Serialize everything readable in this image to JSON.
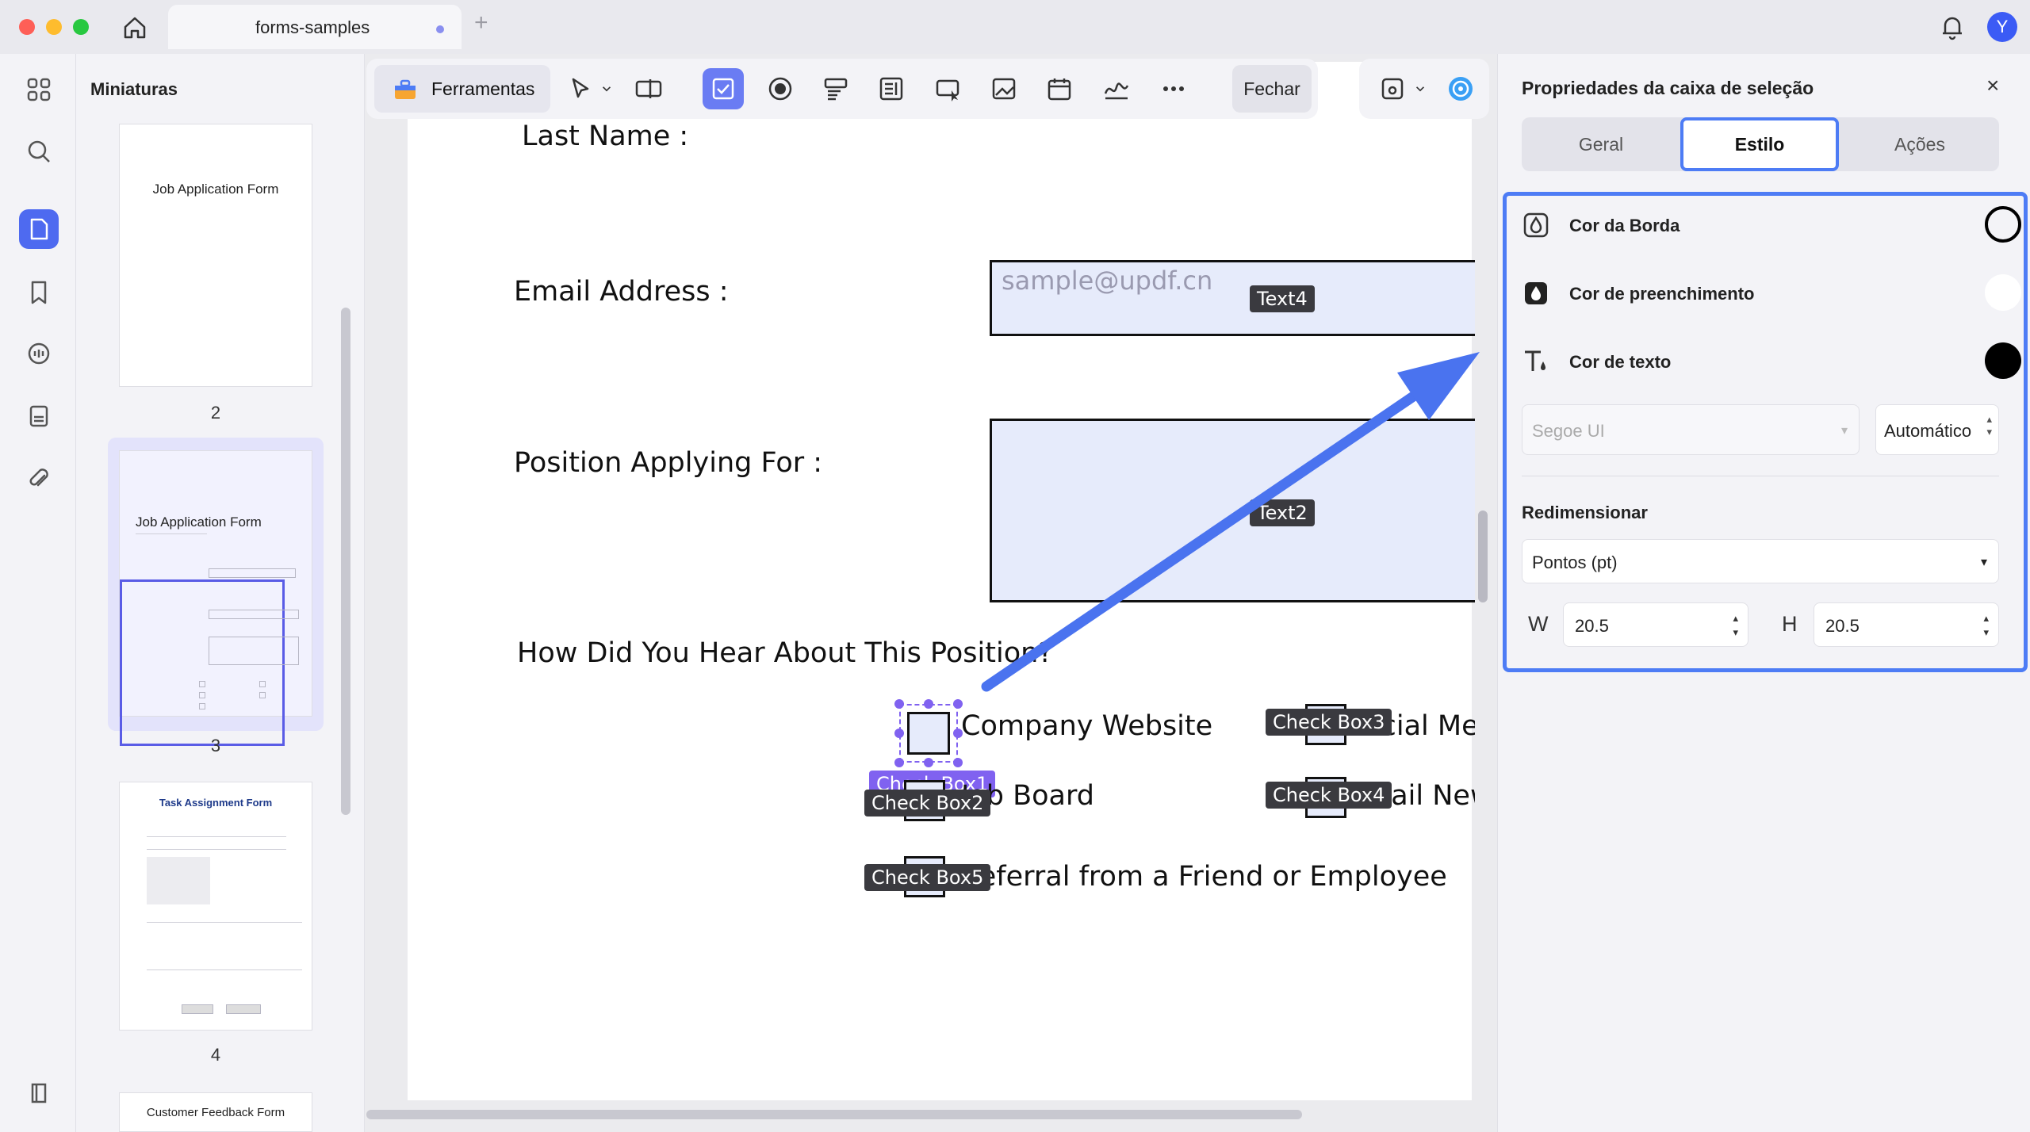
{
  "window": {
    "tab_title": "forms-samples",
    "tab_add": "+",
    "avatar_letter": "Y"
  },
  "sidebar": {
    "title": "Miniaturas",
    "thumbnails": [
      {
        "title": "Job Application Form",
        "page": "2"
      },
      {
        "title": "Job Application Form",
        "page": "3"
      },
      {
        "title": "Task Assignment Form",
        "page": "4"
      },
      {
        "title": "Customer Feedback Form",
        "page": ""
      }
    ]
  },
  "toolbar": {
    "tools_label": "Ferramentas",
    "close_label": "Fechar"
  },
  "form": {
    "last_name_label": "Last Name :",
    "email_label": "Email Address :",
    "email_placeholder": "sample@updf.cn",
    "email_field_tag": "Text4",
    "position_label": "Position Applying For :",
    "position_field_tag": "Text2",
    "question": "How Did You Hear About This Position?",
    "options": [
      {
        "label": "Company Website",
        "tag": "Check Box1"
      },
      {
        "label": "Job Board",
        "tag": "Check Box2"
      },
      {
        "label": "Referral from a Friend or Employee",
        "tag": "Check Box5"
      },
      {
        "label": "Social Media",
        "tag": "Check Box3"
      },
      {
        "label": "Email Newsletter",
        "tag": "Check Box4"
      }
    ]
  },
  "properties": {
    "title": "Propriedades da caixa de seleção",
    "close": "×",
    "tabs": [
      "Geral",
      "Estilo",
      "Ações"
    ],
    "active_tab": "Estilo",
    "border_color_label": "Cor da Borda",
    "fill_color_label": "Cor de preenchimento",
    "text_color_label": "Cor de texto",
    "colors": {
      "border": "#000000",
      "fill": "#ffffff",
      "text": "#000000"
    },
    "font_name": "Segoe UI",
    "font_size": "Automático",
    "resize_title": "Redimensionar",
    "unit": "Pontos (pt)",
    "w_label": "W",
    "w_value": "20.5",
    "h_label": "H",
    "h_value": "20.5"
  },
  "accent_color": "#4d7cf5"
}
